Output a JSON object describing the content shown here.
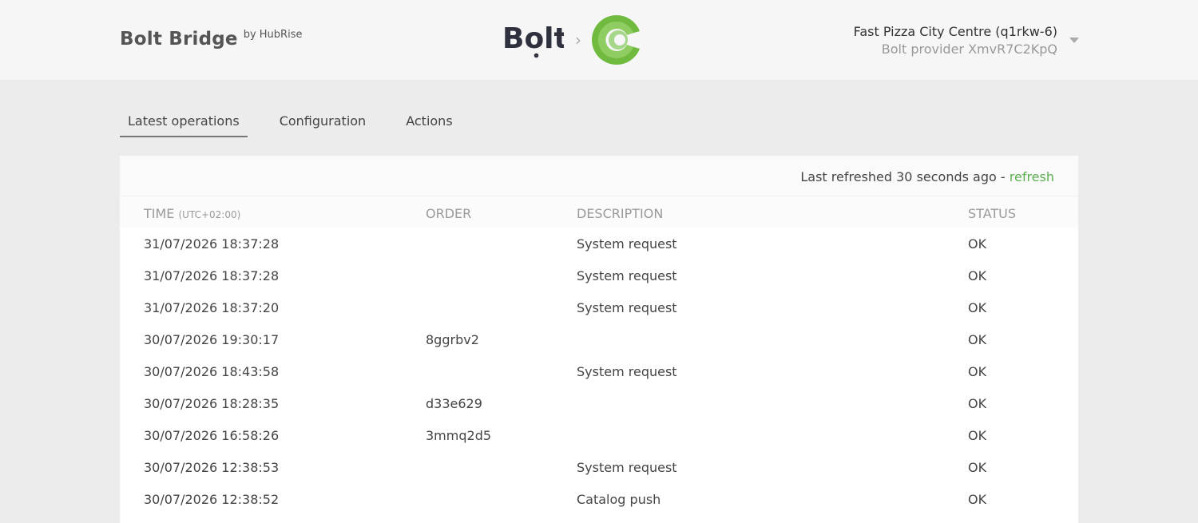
{
  "header": {
    "title": "Bolt Bridge",
    "by": "by HubRise",
    "logo_left": "bolt-logo",
    "separator": "›",
    "logo_right": "hubrise-logo",
    "account_name": "Fast Pizza City Centre (q1rkw-6)",
    "account_sub": "Bolt provider XmvR7C2KpQ"
  },
  "tabs": [
    {
      "label": "Latest operations",
      "active": true
    },
    {
      "label": "Configuration",
      "active": false
    },
    {
      "label": "Actions",
      "active": false
    }
  ],
  "panel": {
    "refresh_text": "Last refreshed 30 seconds ago - ",
    "refresh_link": "refresh",
    "columns": {
      "time": "TIME",
      "time_tz": "(UTC+02:00)",
      "order": "ORDER",
      "description": "DESCRIPTION",
      "status": "STATUS"
    },
    "rows": [
      {
        "time": "31/07/2026 18:37:28",
        "order": "",
        "description": "System request",
        "status": "OK"
      },
      {
        "time": "31/07/2026 18:37:28",
        "order": "",
        "description": "System request",
        "status": "OK"
      },
      {
        "time": "31/07/2026 18:37:20",
        "order": "",
        "description": "System request",
        "status": "OK"
      },
      {
        "time": "30/07/2026 19:30:17",
        "order": "8ggrbv2",
        "description": "",
        "status": "OK"
      },
      {
        "time": "30/07/2026 18:43:58",
        "order": "",
        "description": "System request",
        "status": "OK"
      },
      {
        "time": "30/07/2026 18:28:35",
        "order": "d33e629",
        "description": "",
        "status": "OK"
      },
      {
        "time": "30/07/2026 16:58:26",
        "order": "3mmq2d5",
        "description": "",
        "status": "OK"
      },
      {
        "time": "30/07/2026 12:38:53",
        "order": "",
        "description": "System request",
        "status": "OK"
      },
      {
        "time": "30/07/2026 12:38:52",
        "order": "",
        "description": "Catalog push",
        "status": "OK"
      }
    ]
  },
  "colors": {
    "accent_green": "#5cae4f",
    "hubrise_green_dark": "#6fba3f",
    "hubrise_green_light": "#a6d68a",
    "bolt_text": "#2f313f"
  }
}
